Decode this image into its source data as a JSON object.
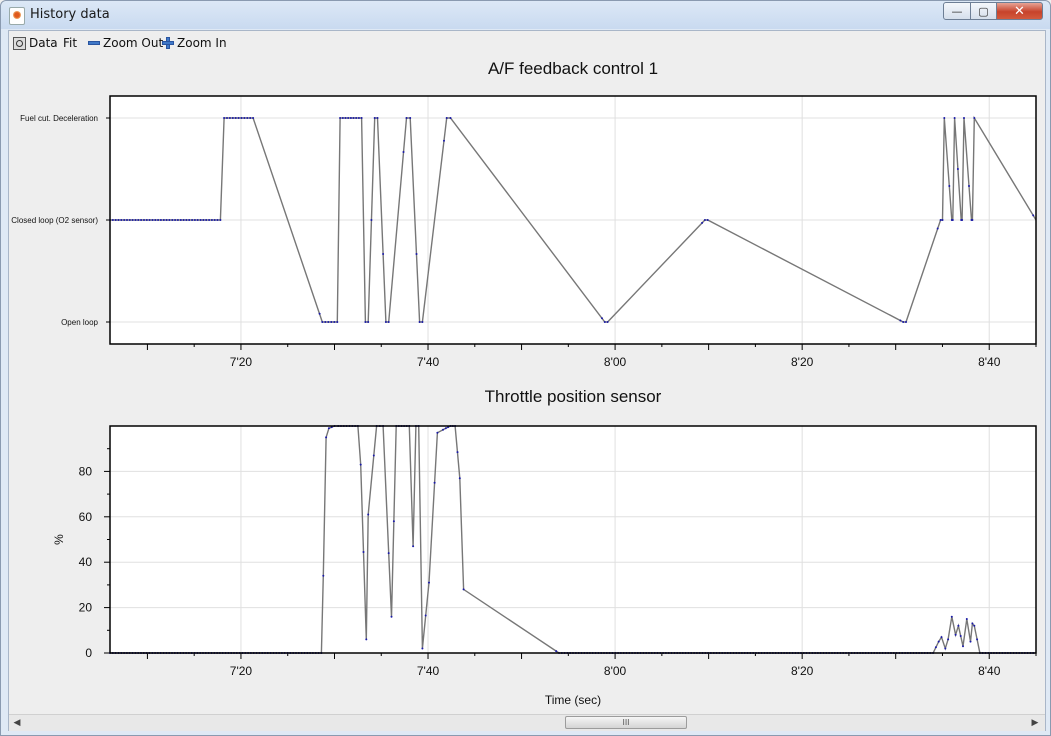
{
  "window": {
    "title": "History data",
    "minimize_label": "—",
    "maximize_label": "▢",
    "close_label": "✕"
  },
  "toolbar": {
    "data_label": "Data",
    "fit_label": "Fit",
    "zoom_out_label": "Zoom Out",
    "zoom_in_label": "Zoom In"
  },
  "scrollbar": {
    "grip": "III"
  },
  "colors": {
    "line": "#777777",
    "point": "#1a1aa8",
    "grid": "#e0e0e0",
    "axis": "#000000"
  },
  "chart_data": [
    {
      "type": "line",
      "title": "A/F feedback control 1",
      "xlabel": "",
      "ylabel": "",
      "x_unit": "seconds",
      "xlim": [
        426,
        525
      ],
      "x_ticks": [
        440,
        460,
        480,
        500,
        520
      ],
      "x_tick_labels": [
        "7'20",
        "7'40",
        "8'00",
        "8'20",
        "8'40"
      ],
      "y_categories": [
        "Open loop",
        "Closed loop (O2 sensor)",
        "Fuel cut. Deceleration"
      ],
      "grid": true,
      "series": [
        {
          "x": [
            426,
            437.8,
            438.2,
            441.3,
            448.7,
            450.3,
            450.6,
            452.9,
            453.3,
            453.6,
            454.3,
            454.6,
            455.5,
            455.8,
            457.7,
            458.1,
            459.1,
            459.4,
            462.0,
            462.4,
            478.9,
            479.2,
            489.6,
            489.9,
            510.8,
            511.1,
            514.8,
            515.0,
            515.2,
            516.0,
            516.1,
            516.3,
            517.0,
            517.1,
            517.3,
            518.1,
            518.2,
            518.4,
            525
          ],
          "y": [
            1,
            1,
            2,
            2,
            0,
            0,
            2,
            2,
            0,
            0,
            2,
            2,
            0,
            0,
            2,
            2,
            0,
            0,
            2,
            2,
            0,
            0,
            1,
            1,
            0,
            0,
            1,
            1,
            2,
            1,
            1,
            2,
            1,
            1,
            2,
            1,
            1,
            2,
            1
          ]
        }
      ]
    },
    {
      "type": "line",
      "title": "Throttle position sensor",
      "xlabel": "Time (sec)",
      "ylabel": "%",
      "x_unit": "seconds",
      "xlim": [
        426,
        525
      ],
      "ylim": [
        0,
        100
      ],
      "x_ticks": [
        440,
        460,
        480,
        500,
        520
      ],
      "x_tick_labels": [
        "7'20",
        "7'40",
        "8'00",
        "8'20",
        "8'40"
      ],
      "y_ticks": [
        0,
        20,
        40,
        60,
        80
      ],
      "grid": true,
      "series": [
        {
          "x": [
            426,
            448.6,
            448.8,
            449.1,
            449.4,
            450.0,
            450.4,
            452.5,
            452.8,
            453.4,
            453.6,
            454.5,
            455.2,
            456.1,
            456.6,
            458.0,
            458.4,
            458.7,
            459.0,
            459.4,
            460.1,
            461.0,
            461.9,
            462.4,
            462.9,
            463.4,
            463.8,
            474.0,
            508.0,
            514.0,
            514.6,
            514.9,
            515.3,
            515.6,
            516.0,
            516.4,
            516.7,
            517.2,
            517.6,
            518.0,
            518.2,
            518.4,
            519.0,
            525
          ],
          "y": [
            0,
            0,
            34,
            95,
            99,
            100,
            100,
            100,
            83,
            6,
            61,
            100,
            100,
            16,
            100,
            100,
            47,
            100,
            100,
            2,
            31,
            97,
            99,
            100,
            100,
            77,
            28,
            0,
            0,
            0,
            5,
            7,
            2,
            6,
            16,
            8,
            12,
            3,
            15,
            5,
            13,
            12,
            0,
            0
          ]
        }
      ]
    }
  ]
}
